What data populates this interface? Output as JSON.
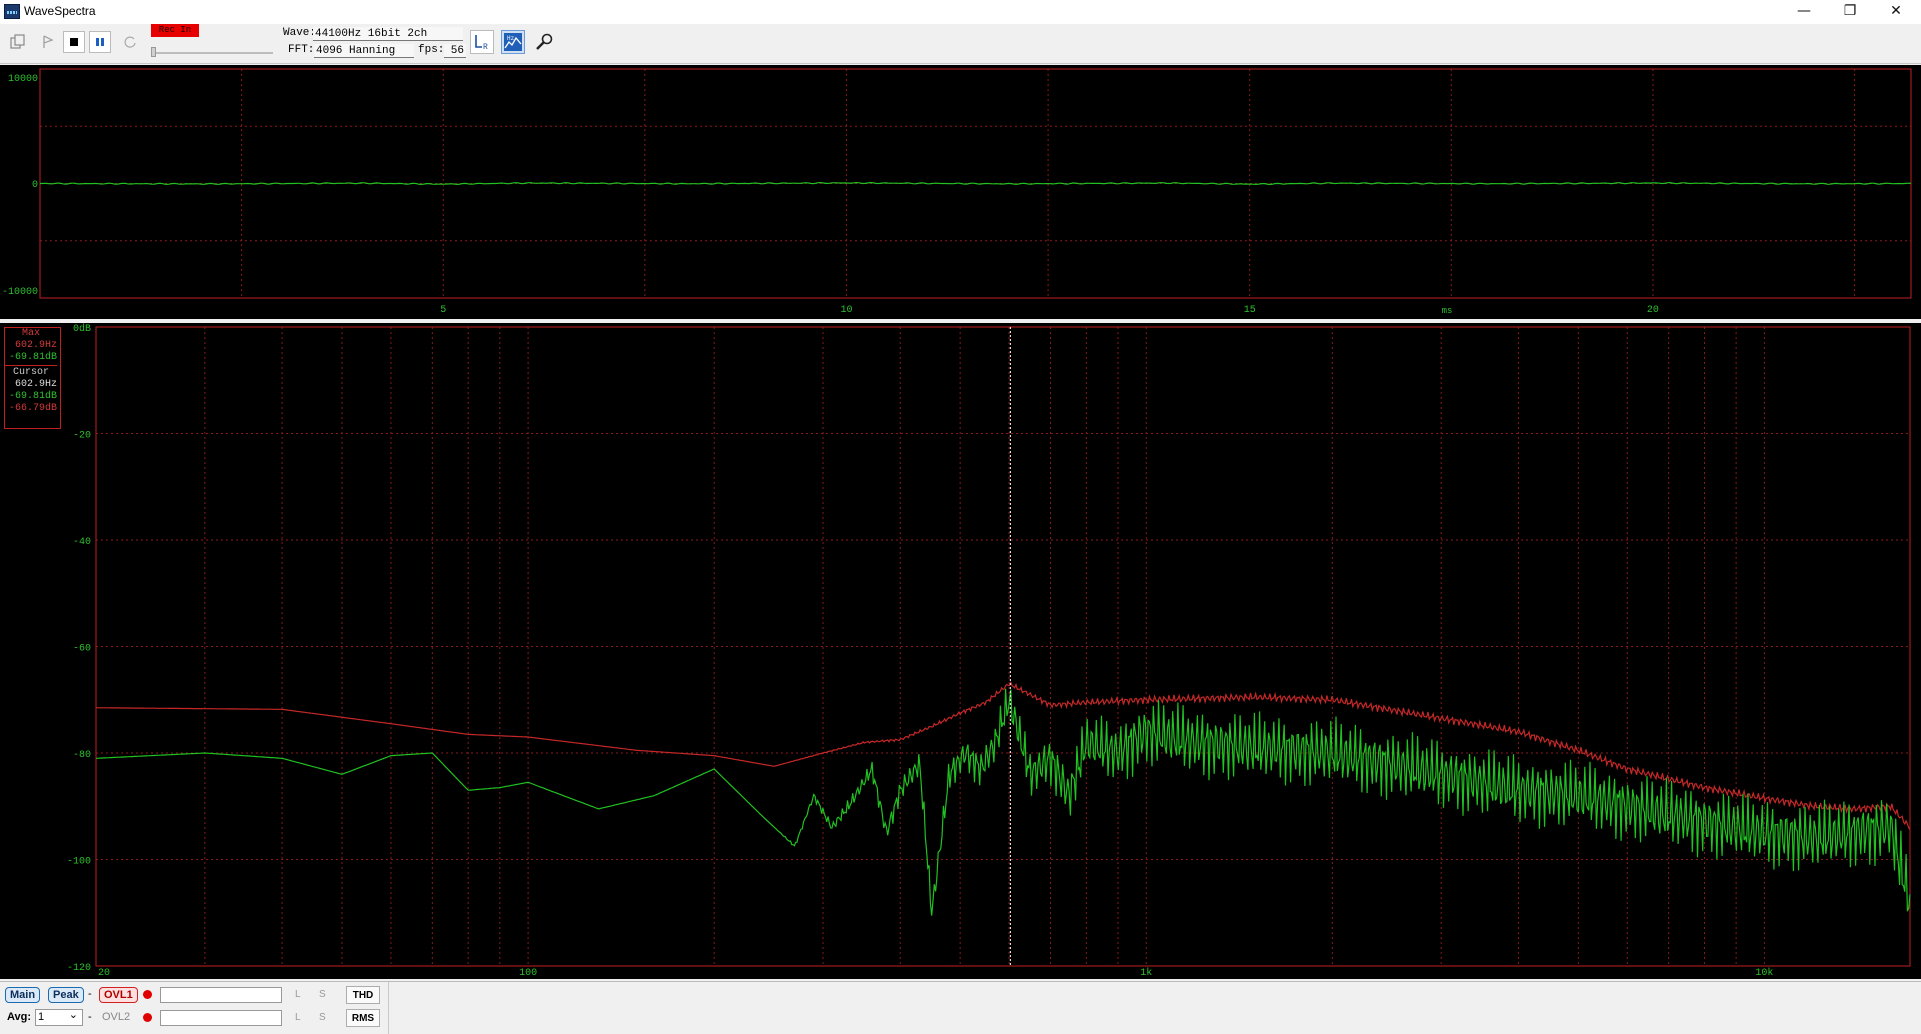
{
  "window": {
    "title": "WaveSpectra",
    "minimize_glyph": "—",
    "restore_glyph": "❐",
    "close_glyph": "✕"
  },
  "toolbar": {
    "rec_badge": "Rec In",
    "wave_label": "Wave:",
    "wave_value": "44100Hz 16bit 2ch",
    "fft_label": "FFT:",
    "fft_value": "4096 Hanning",
    "fps_label": "fps:",
    "fps_value": "56",
    "icons": [
      "copy-icon",
      "play-icon",
      "stop-icon",
      "pause-icon",
      "loop-icon",
      "lr-channel-icon",
      "spectrum-settings-icon",
      "wrench-icon"
    ]
  },
  "waveform": {
    "y_ticks": [
      "10000",
      "0",
      "-10000"
    ],
    "x_ticks": [
      "5",
      "10",
      "15",
      "20"
    ],
    "unit": "ms",
    "trace_color": "#21c121",
    "axis_color": "#c02020",
    "grid_color": "#8a1a1a",
    "xlim": [
      0,
      23.2
    ],
    "ylim": [
      -10000,
      10000
    ]
  },
  "spectrum": {
    "y_ticks": [
      "0dB",
      "-20",
      "-40",
      "-60",
      "-80",
      "-100",
      "-120"
    ],
    "x_ticks": [
      "20",
      "100",
      "1k",
      "10k"
    ],
    "max_label": "Max",
    "max_freq": "602.9Hz",
    "max_db": "-69.81dB",
    "cursor_label": "Cursor",
    "cursor_freq": "602.9Hz",
    "cursor_db_green": "-69.81dB",
    "cursor_db_red": "-66.79dB",
    "cursor_hz": 602.9,
    "xlim_hz": [
      20,
      17200
    ],
    "ylim_db": [
      -120,
      0
    ],
    "log_x": true,
    "green_color": "#21c121",
    "red_color": "#c62828"
  },
  "status": {
    "main_btn": "Main",
    "peak_btn": "Peak",
    "dash": "-",
    "ovl1": "OVL1",
    "ovl2": "OVL2",
    "l_label": "L",
    "s_label": "S",
    "thd_btn": "THD",
    "rms_btn": "RMS",
    "avg_label": "Avg:",
    "avg_value": "1",
    "dropdown_glyph": "⌄"
  },
  "chart_data": [
    {
      "type": "line",
      "xlabel": "ms",
      "xlim": [
        0,
        23.2
      ],
      "ylim": [
        -10000,
        10000
      ],
      "x_ticks": [
        5,
        10,
        15,
        20
      ],
      "y_ticks": [
        10000,
        0,
        -10000
      ],
      "grid": true,
      "series": [
        {
          "x": [
            0,
            2,
            4,
            5,
            6,
            8,
            10,
            12,
            14,
            15,
            16,
            18,
            20,
            22,
            23.2
          ],
          "y": [
            0,
            -40,
            30,
            -60,
            40,
            -20,
            50,
            -30,
            40,
            -60,
            30,
            -20,
            40,
            -30,
            0
          ]
        }
      ]
    },
    {
      "type": "line",
      "log_x": true,
      "xlim": [
        20,
        17200
      ],
      "ylim": [
        -120,
        0
      ],
      "x_ticks": [
        "20",
        "100",
        "1k",
        "10k"
      ],
      "y_ticks": [
        "0dB",
        "-20",
        "-40",
        "-60",
        "-80",
        "-100",
        "-120"
      ],
      "grid": true,
      "series": [
        {
          "color": "#c62828",
          "x": [
            20,
            40,
            60,
            80,
            100,
            150,
            200,
            250,
            300,
            350,
            400,
            450,
            500,
            550,
            600,
            700,
            800,
            1000,
            1500,
            2000,
            3000,
            4000,
            5000,
            6000,
            8000,
            10000,
            12000,
            14000,
            16000,
            17200
          ],
          "y": [
            -71.5,
            -71.8,
            -74.5,
            -76.5,
            -77,
            -79.5,
            -80.5,
            -82.5,
            -80,
            -78,
            -77.5,
            -75,
            -72.5,
            -70.5,
            -67,
            -71,
            -70.5,
            -70,
            -69.5,
            -70,
            -73.5,
            -76,
            -79.5,
            -83,
            -86.5,
            -88.5,
            -90,
            -90.5,
            -90,
            -94
          ]
        },
        {
          "color": "#21c121",
          "x": [
            20,
            30,
            40,
            50,
            60,
            70,
            80,
            90,
            100,
            130,
            160,
            200,
            240,
            270,
            290,
            310,
            330,
            360,
            380,
            400,
            430,
            450,
            480,
            510,
            540,
            570,
            600,
            650,
            700,
            750,
            800,
            900,
            1000,
            1200,
            1500,
            2000,
            3000,
            4000,
            5000,
            6000,
            8000,
            10000,
            12000,
            14000,
            16000,
            17200
          ],
          "y": [
            -81,
            -80,
            -81,
            -84,
            -80.5,
            -80,
            -87,
            -86.5,
            -85.5,
            -90.5,
            -88,
            -83,
            -92,
            -97.5,
            -88,
            -94,
            -90,
            -83,
            -95,
            -87,
            -82,
            -110,
            -84,
            -80,
            -83,
            -78,
            -70,
            -84,
            -81,
            -88,
            -78,
            -80,
            -76,
            -78,
            -79,
            -80,
            -84,
            -87,
            -88,
            -90,
            -93,
            -95,
            -96,
            -95,
            -94,
            -108
          ]
        }
      ],
      "cursor_x": 602.9
    }
  ]
}
